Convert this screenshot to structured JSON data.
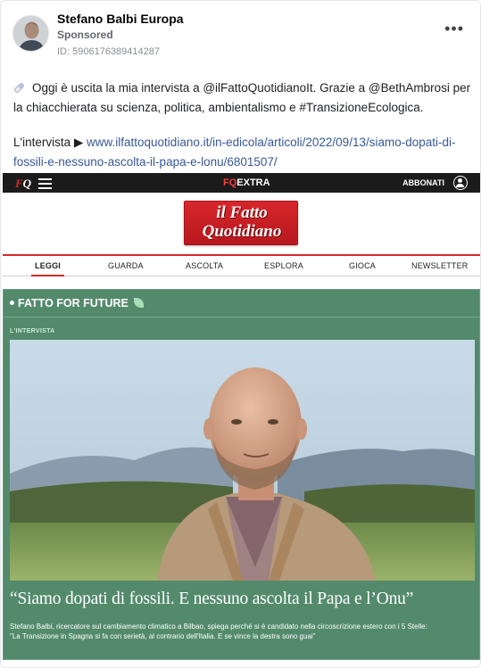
{
  "post": {
    "author": "Stefano Balbi Europa",
    "sponsored": "Sponsored",
    "ad_id": "ID: 5906176389414287",
    "more_label": "•••",
    "text": "Oggi è uscita la mia intervista a @ilFattoQuotidianoIt. Grazie a @BethAmbrosi per la chiacchierata su scienza, politica, ambientalismo e #TransizioneEcologica.",
    "link_prefix": "L'intervista ▶",
    "link_url": "www.ilfattoquotidiano.it/in-edicola/articoli/2022/09/13/siamo-dopati-di-fossili-e-nessuno-ascolta-il-papa-e-lonu/6801507/"
  },
  "colors": {
    "link": "#385898",
    "green_panel": "#538a6c",
    "brand_red": "#d6282a"
  },
  "site": {
    "logo_f": "F",
    "logo_q": "Q",
    "fq": "FQ",
    "extra": "EXTRA",
    "abbonati": "ABBONATI",
    "masthead_line1": "il Fatto",
    "masthead_line2": "Quotidiano",
    "nav": [
      "LEGGI",
      "GUARDA",
      "ASCOLTA",
      "ESPLORA",
      "GIOCA",
      "NEWSLETTER"
    ],
    "section": "FATTO FOR FUTURE",
    "tag": "L'INTERVISTA",
    "headline": "“Siamo dopati di fossili. E nessuno ascolta il Papa e l’Onu”",
    "caption_line1": "Stefano Balbi, ricercatore sul cambiamento climatico a Bilbao, spiega perché si è candidato nella circoscrizione estero con i 5 Stelle:",
    "caption_line2": "\"La Transizione in Spagna si fa con serietà, al contrario dell'Italia. E se vince la destra sono guai\""
  }
}
